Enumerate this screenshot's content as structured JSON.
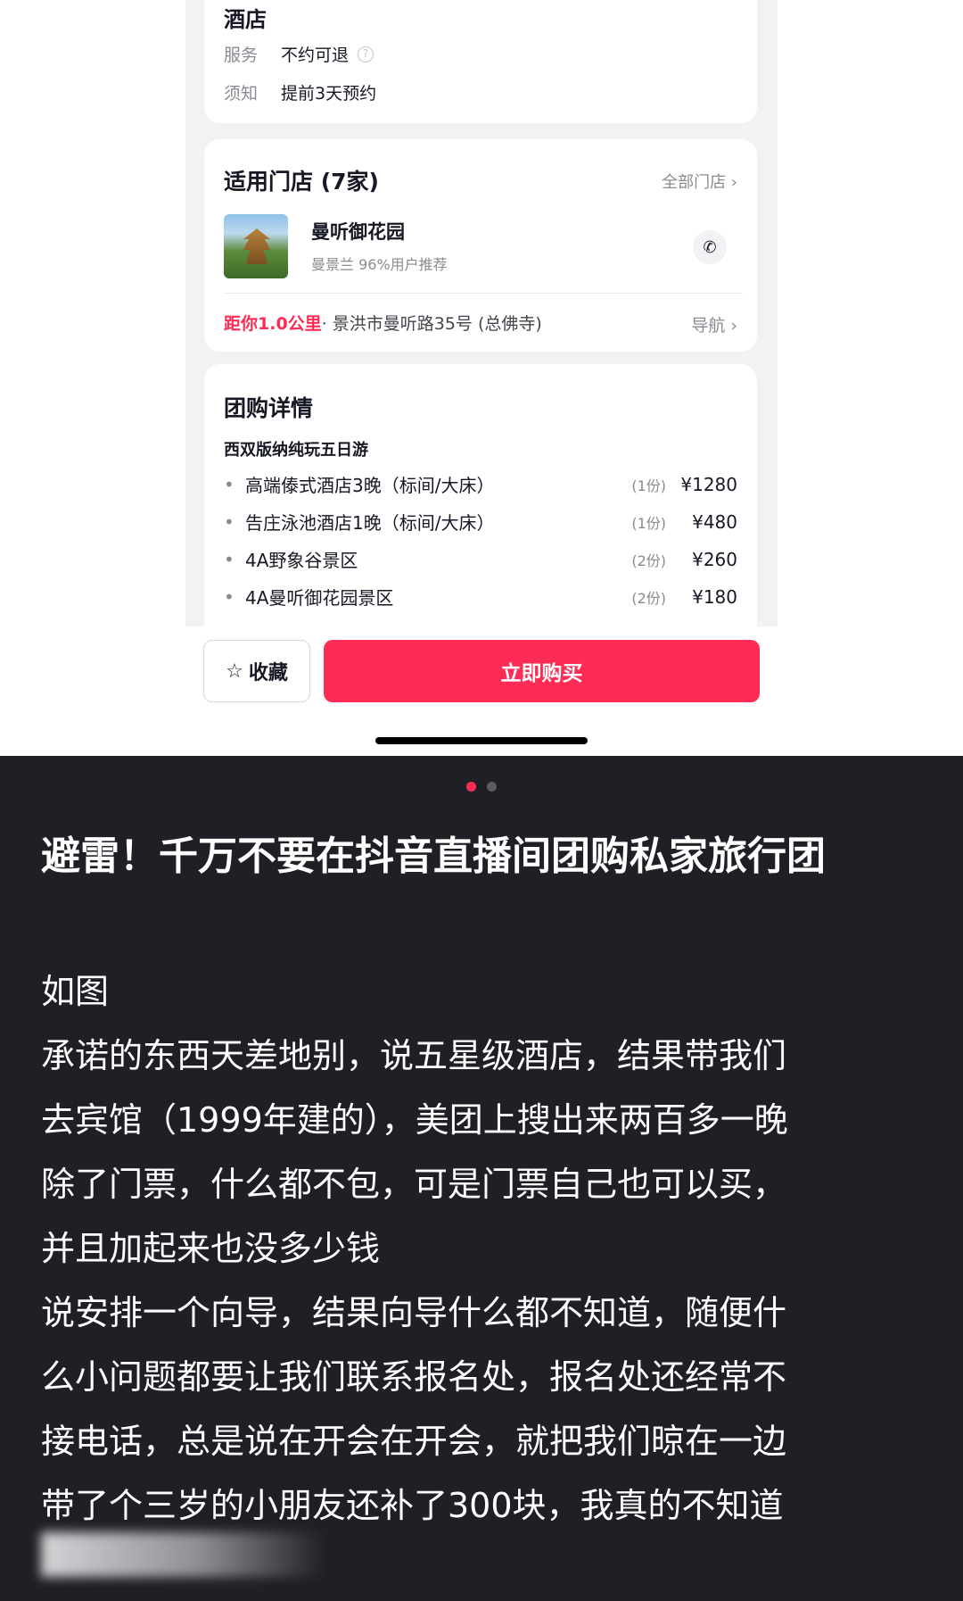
{
  "hotel_card": {
    "title": "酒店",
    "service_key": "服务",
    "service_val": "不约可退",
    "notice_key": "须知",
    "notice_val": "提前3天预约"
  },
  "store_card": {
    "title": "适用门店 (7家)",
    "all_link": "全部门店 ›",
    "store_name": "曼听御花园",
    "store_meta": "曼景兰   96%用户推荐",
    "distance": "距你1.0公里",
    "address": " · 景洪市曼听路35号 (总佛寺)",
    "nav": "导航 ›"
  },
  "detail_card": {
    "title": "团购详情",
    "subtitle": "西双版纳纯玩五日游",
    "items": [
      {
        "name": "高端傣式酒店3晚（标间/大床）",
        "qty": "(1份)",
        "price": "¥1280"
      },
      {
        "name": "告庄泳池酒店1晚（标间/大床）",
        "qty": "(1份)",
        "price": "¥480"
      },
      {
        "name": "4A野象谷景区",
        "qty": "(2份)",
        "price": "¥260"
      },
      {
        "name": "4A曼听御花园景区",
        "qty": "(2份)",
        "price": "¥180"
      }
    ]
  },
  "bottom_bar": {
    "fav_label": "收藏",
    "buy_label": "立即购买"
  },
  "post": {
    "title": "避雷！千万不要在抖音直播间团购私家旅行团",
    "lines": [
      "如图",
      "承诺的东西天差地别，说五星级酒店，结果带我们",
      "去宾馆（1999年建的），美团上搜出来两百多一晚",
      "除了门票，什么都不包，可是门票自己也可以买，",
      "并且加起来也没多少钱",
      "说安排一个向导，结果向导什么都不知道，随便什",
      "么小问题都要让我们联系报名处，报名处还经常不",
      "接电话，总是说在开会在开会，就把我们晾在一边",
      "带了个三岁的小朋友还补了300块，我真的不知道"
    ]
  },
  "colors": {
    "accent": "#fe2c55",
    "dark_bg": "#1f1f26",
    "light_bg": "#f2f2f4"
  },
  "icons": [
    "help-icon",
    "phone-icon",
    "star-icon",
    "chevron-right-icon"
  ]
}
